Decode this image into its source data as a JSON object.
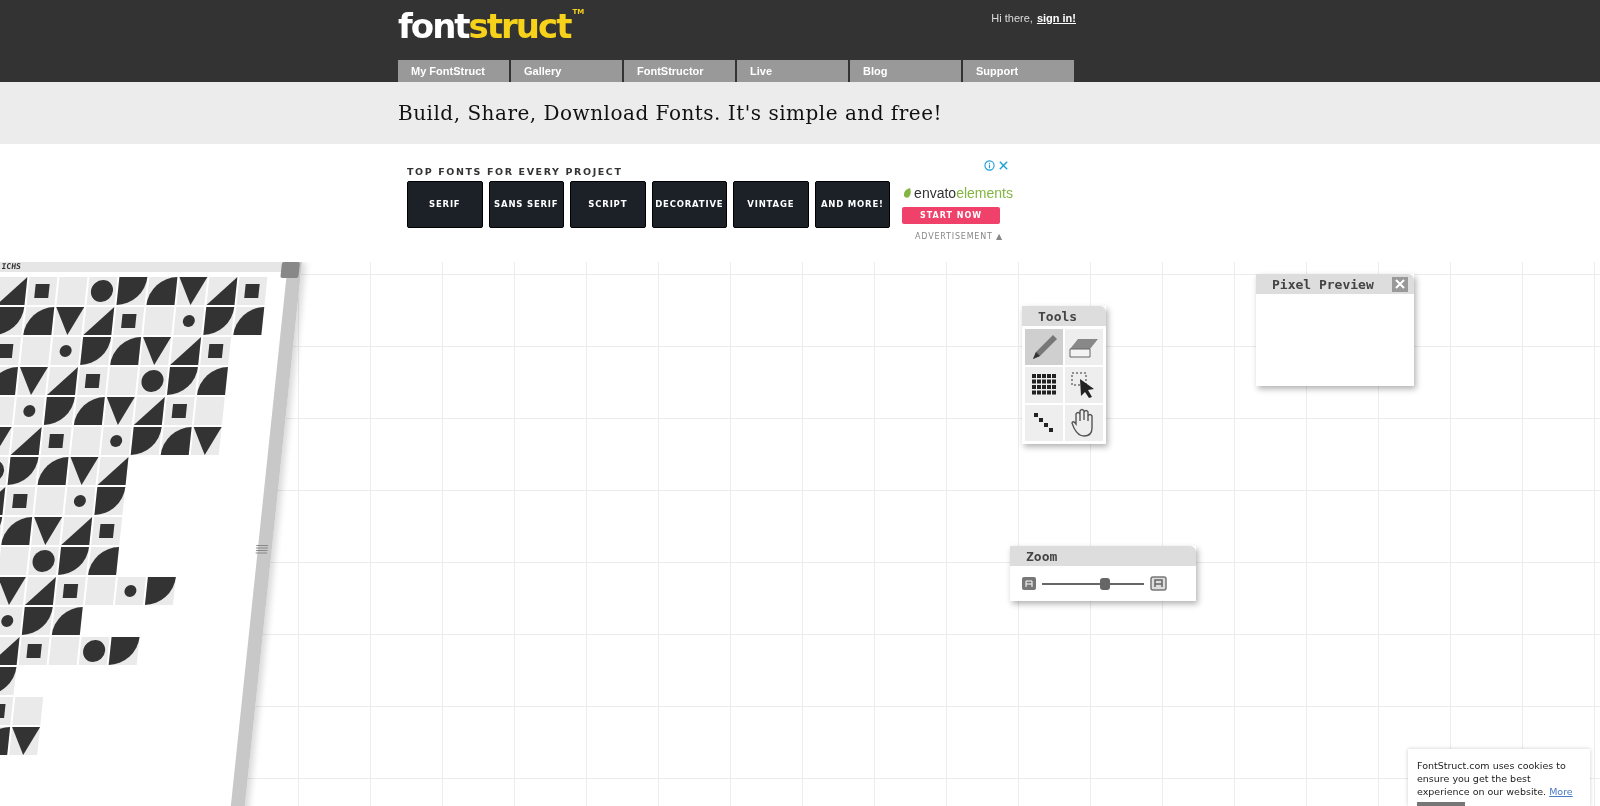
{
  "header": {
    "logo": {
      "light": "font",
      "bright": "struct",
      "mark": "TM"
    },
    "greeting": "Hi there,",
    "sign_in": "sign in!"
  },
  "nav": [
    {
      "label": "My FontStruct",
      "selected": false
    },
    {
      "label": "Gallery",
      "selected": false
    },
    {
      "label": "FontStructor",
      "selected": false
    },
    {
      "label": "Live",
      "selected": false
    },
    {
      "label": "Blog",
      "selected": false
    },
    {
      "label": "Support",
      "selected": false
    }
  ],
  "tagline": "Build, Share, Download Fonts. It's simple and free!",
  "ad": {
    "heading": "TOP FONTS FOR EVERY PROJECT",
    "tiles": [
      "SERIF",
      "SANS SERIF",
      "SCRIPT",
      "DECORATIVE",
      "VINTAGE",
      "AND MORE!"
    ],
    "brand_a": "envato",
    "brand_b": "elements",
    "cta": "START NOW",
    "footer": "ADVERTISEMENT ▲"
  },
  "bricks_panel": {
    "title": "ICHS"
  },
  "tools": {
    "title": "Tools",
    "items": [
      {
        "kind": "pencil",
        "selected": true
      },
      {
        "kind": "eraser",
        "selected": false
      },
      {
        "kind": "grid",
        "selected": false
      },
      {
        "kind": "select",
        "selected": false
      },
      {
        "kind": "line",
        "selected": false
      },
      {
        "kind": "hand",
        "selected": false
      }
    ]
  },
  "pixel_preview": {
    "title": "Pixel Preview"
  },
  "zoom": {
    "title": "Zoom",
    "level": 0.62
  },
  "cookie": {
    "text": "FontStruct.com uses cookies to ensure you get the best experience on our website.",
    "link": "More"
  }
}
